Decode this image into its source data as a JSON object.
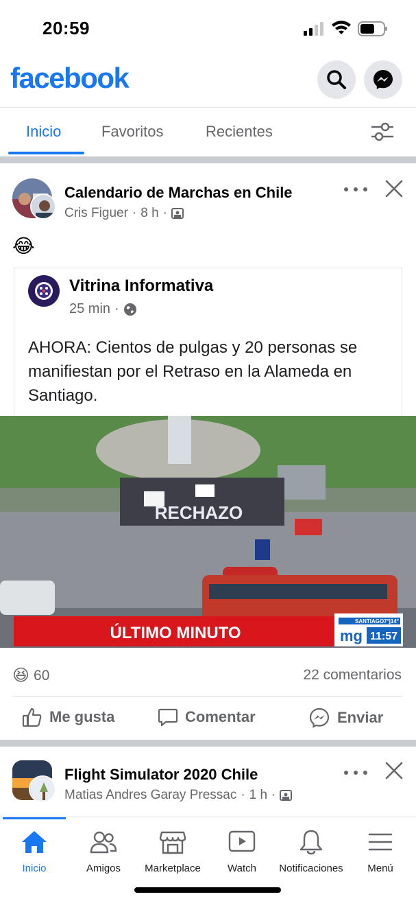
{
  "status": {
    "time": "20:59"
  },
  "header": {
    "logo": "facebook",
    "search_icon": "search-icon",
    "messenger_icon": "messenger-icon"
  },
  "tabs": [
    {
      "label": "Inicio",
      "active": true
    },
    {
      "label": "Favoritos",
      "active": false
    },
    {
      "label": "Recientes",
      "active": false
    }
  ],
  "post1": {
    "title": "Calendario de Marchas en Chile",
    "author": "Cris Figuer",
    "time": "8 h",
    "caption_emoji": "😂",
    "shared": {
      "page_name": "Vitrina Informativa",
      "time": "25 min",
      "text": "AHORA: Cientos de pulgas y 20 personas se manifiestan por el Retraso en la Alameda en Santiago."
    },
    "image": {
      "banner_text": "ÚLTIMO MINUTO",
      "sign_text": "RECHAZO",
      "channel_logo": "mg",
      "location": "SANTIAGO",
      "temp": "7°|14°",
      "clock": "11:57"
    },
    "reaction_emoji": "😆",
    "reaction_count": "60",
    "comments": "22 comentarios",
    "actions": {
      "like": "Me gusta",
      "comment": "Comentar",
      "send": "Enviar"
    }
  },
  "post2": {
    "title": "Flight Simulator 2020 Chile",
    "author": "Matias Andres Garay Pressac",
    "time": "1 h"
  },
  "bottom_nav": [
    {
      "label": "Inicio",
      "icon": "home-icon",
      "active": true
    },
    {
      "label": "Amigos",
      "icon": "friends-icon",
      "active": false
    },
    {
      "label": "Marketplace",
      "icon": "marketplace-icon",
      "active": false
    },
    {
      "label": "Watch",
      "icon": "watch-icon",
      "active": false
    },
    {
      "label": "Notificaciones",
      "icon": "bell-icon",
      "active": false
    },
    {
      "label": "Menú",
      "icon": "menu-icon",
      "active": false
    }
  ],
  "colors": {
    "brand": "#1877f2",
    "secondary_text": "#65676b",
    "banner": "#d8161b"
  }
}
